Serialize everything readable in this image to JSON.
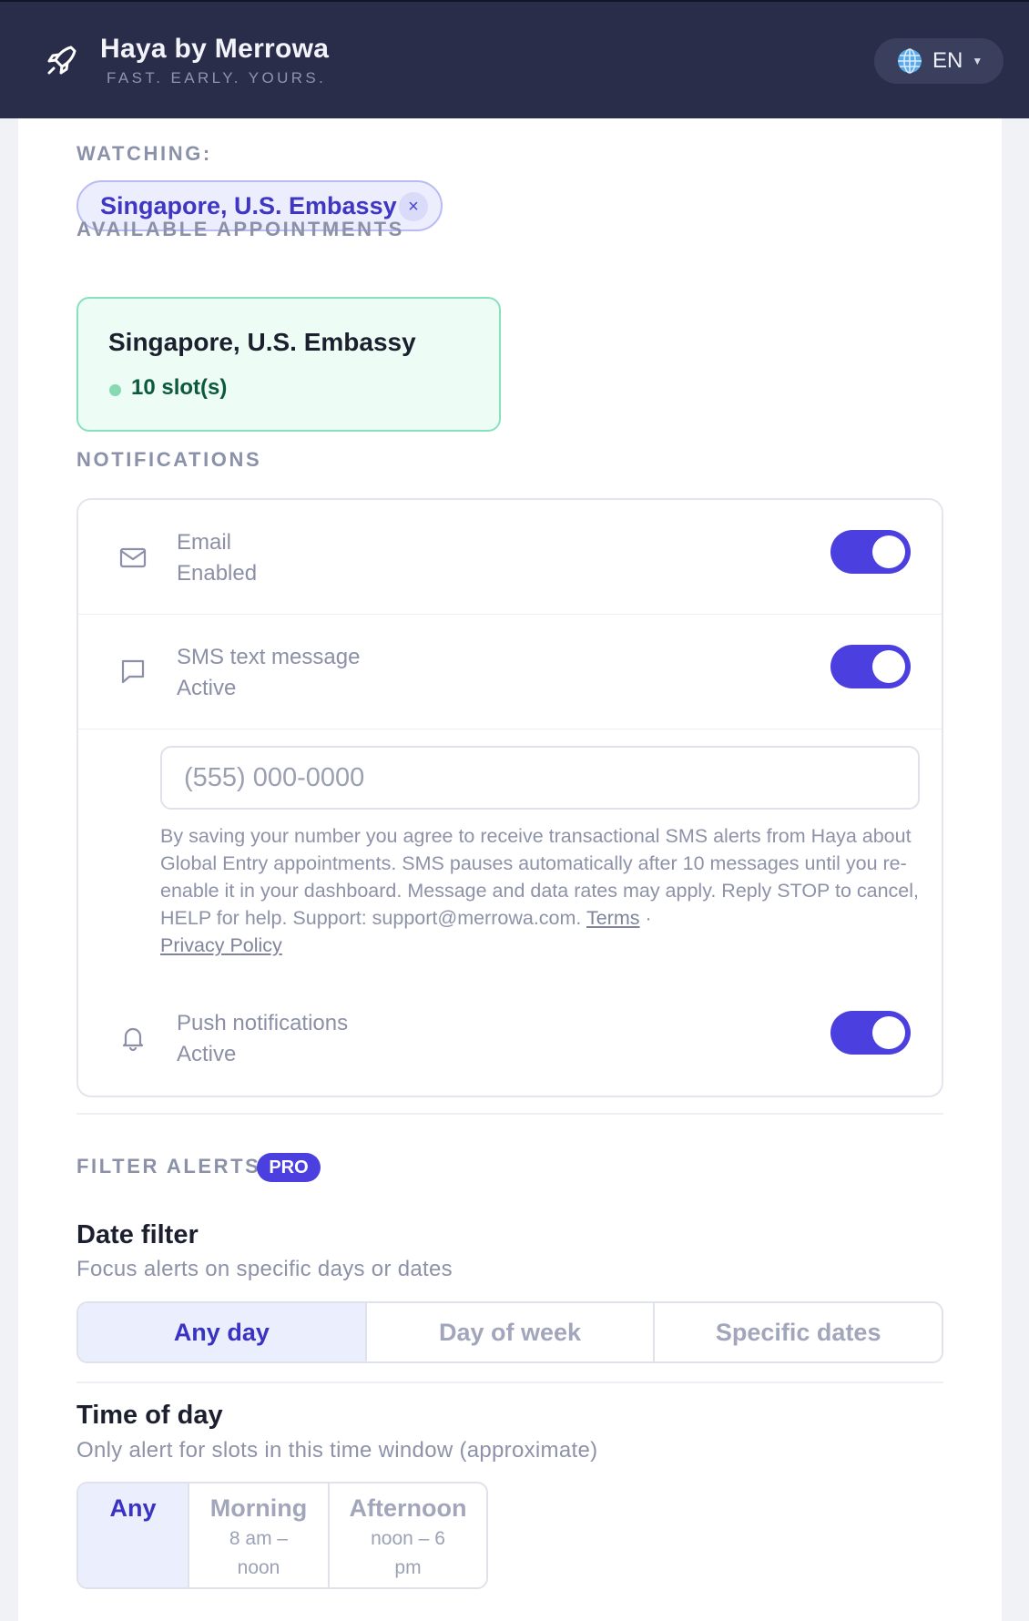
{
  "header": {
    "title": "Haya by Merrowa",
    "tagline": "FAST. EARLY. YOURS.",
    "language": "EN"
  },
  "watching": {
    "label": "WATCHING:",
    "chip_label": "Singapore, U.S. Embassy",
    "remove_symbol": "×"
  },
  "appointments": {
    "label": "AVAILABLE APPOINTMENTS",
    "items": [
      {
        "location": "Singapore, U.S. Embassy",
        "slots": "10 slot(s)"
      }
    ]
  },
  "notifications": {
    "label": "NOTIFICATIONS",
    "email": {
      "title": "Email",
      "status": "Enabled",
      "enabled": true
    },
    "sms": {
      "title": "SMS text message",
      "status": "Active",
      "enabled": true,
      "phone_placeholder": "(555) 000-0000",
      "consent_text": "By saving your number you agree to receive transactional SMS alerts from Haya about Global Entry appointments. SMS pauses automatically after 10 messages until you re-enable it in your dashboard. Message and data rates may apply. Reply STOP to cancel, HELP for help. Support: support@merrowa.com.",
      "terms_link": "Terms",
      "separator": "·",
      "privacy_link": "Privacy Policy"
    },
    "push": {
      "title": "Push notifications",
      "status": "Active",
      "enabled": true
    }
  },
  "filters": {
    "label": "FILTER ALERTS",
    "badge": "PRO",
    "date_filter": {
      "title": "Date filter",
      "description": "Focus alerts on specific days or dates",
      "options": [
        "Any day",
        "Day of week",
        "Specific dates"
      ],
      "selected": "Any day"
    },
    "time_of_day": {
      "title": "Time of day",
      "description": "Only alert for slots in this time window (approximate)",
      "options": [
        {
          "label": "Any",
          "line1": "",
          "line2": ""
        },
        {
          "label": "Morning",
          "line1": "8 am –",
          "line2": "noon"
        },
        {
          "label": "Afternoon",
          "line1": "noon – 6",
          "line2": "pm"
        }
      ],
      "selected": "Any"
    }
  },
  "colors": {
    "header_bg": "#2a2d4a",
    "accent": "#4b3fe0",
    "available_green": "#86e2bc"
  }
}
